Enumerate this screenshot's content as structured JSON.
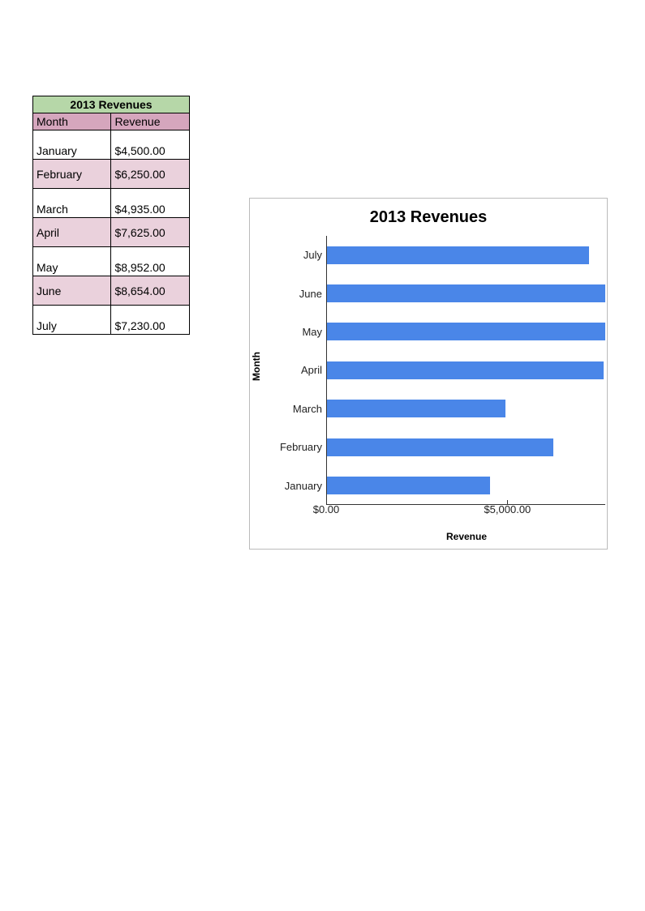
{
  "table": {
    "title": "2013 Revenues",
    "col1": "Month",
    "col2": "Revenue",
    "rows": [
      {
        "month": "January",
        "revenue": "$4,500.00",
        "alt": false
      },
      {
        "month": "February",
        "revenue": "$6,250.00",
        "alt": true
      },
      {
        "month": "March",
        "revenue": "$4,935.00",
        "alt": false
      },
      {
        "month": "April",
        "revenue": "$7,625.00",
        "alt": true
      },
      {
        "month": "May",
        "revenue": "$8,952.00",
        "alt": false
      },
      {
        "month": "June",
        "revenue": "$8,654.00",
        "alt": true
      },
      {
        "month": "July",
        "revenue": "$7,230.00",
        "alt": false
      }
    ]
  },
  "chart": {
    "title": "2013 Revenues",
    "ylabel": "Month",
    "xlabel": "Revenue",
    "xticks": [
      "$0.00",
      "$5,000.00"
    ],
    "xtick_values": [
      0,
      5000
    ],
    "clip_max": 7700
  },
  "chart_data": {
    "type": "bar",
    "orientation": "horizontal",
    "categories": [
      "January",
      "February",
      "March",
      "April",
      "May",
      "June",
      "July"
    ],
    "display_order": [
      "July",
      "June",
      "May",
      "April",
      "March",
      "February",
      "January"
    ],
    "values": [
      4500,
      6250,
      4935,
      7625,
      8952,
      8654,
      7230
    ],
    "title": "2013 Revenues",
    "xlabel": "Revenue",
    "ylabel": "Month",
    "xlim": [
      0,
      10000
    ],
    "x_ticks_shown": [
      0,
      5000
    ],
    "bar_color": "#4a86e8",
    "note": "Chart is visually clipped on the right edge around ~$7,700"
  }
}
